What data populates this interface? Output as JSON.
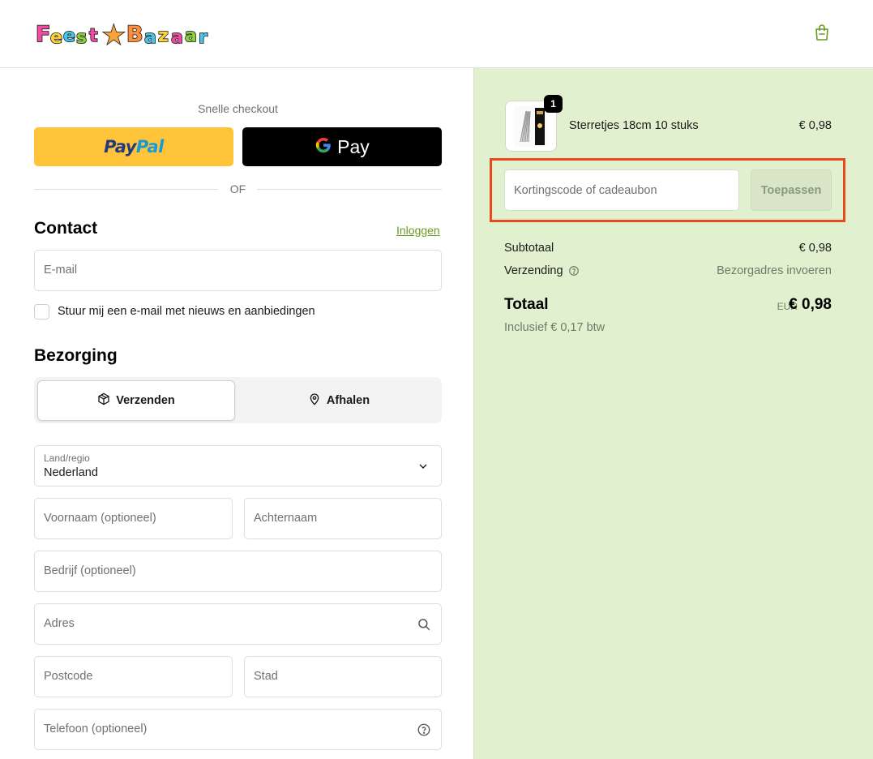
{
  "header": {
    "logo_text": "FEEST BAZAAR",
    "logo_letters": [
      "F",
      "e",
      "e",
      "s",
      "t",
      "★",
      "B",
      "a",
      "z",
      "a",
      "a",
      "r"
    ],
    "cart_icon": "shopping-bag-icon"
  },
  "express": {
    "title": "Snelle checkout",
    "paypal": {
      "pay": "Pay",
      "pal": "Pal"
    },
    "gpay_label": "Pay",
    "or_label": "OF"
  },
  "contact": {
    "title": "Contact",
    "login_link": "Inloggen",
    "email_placeholder": "E-mail",
    "newsletter_label": "Stuur mij een e-mail met nieuws en aanbiedingen"
  },
  "delivery": {
    "title": "Bezorging",
    "options": [
      {
        "label": "Verzenden",
        "icon": "package-icon",
        "selected": true
      },
      {
        "label": "Afhalen",
        "icon": "location-pin-icon",
        "selected": false
      }
    ],
    "country_label": "Land/regio",
    "country_value": "Nederland",
    "first_name_placeholder": "Voornaam (optioneel)",
    "last_name_placeholder": "Achternaam",
    "company_placeholder": "Bedrijf (optioneel)",
    "address_placeholder": "Adres",
    "postcode_placeholder": "Postcode",
    "city_placeholder": "Stad",
    "phone_placeholder": "Telefoon (optioneel)"
  },
  "summary": {
    "product": {
      "name": "Sterretjes 18cm 10 stuks",
      "price": "€ 0,98",
      "quantity": "1"
    },
    "discount_placeholder": "Kortingscode of cadeaubon",
    "apply_label": "Toepassen",
    "subtotal_label": "Subtotaal",
    "subtotal_value": "€ 0,98",
    "shipping_label": "Verzending",
    "shipping_value": "Bezorgadres invoeren",
    "total_label": "Totaal",
    "total_currency": "EUR",
    "total_value": "€ 0,98",
    "tax_note": "Inclusief € 0,17 btw"
  },
  "colors": {
    "accent_link": "#6a9a1f",
    "summary_bg": "#e1f0cf",
    "highlight_border": "#e8491d",
    "paypal_yellow": "#ffc439"
  }
}
